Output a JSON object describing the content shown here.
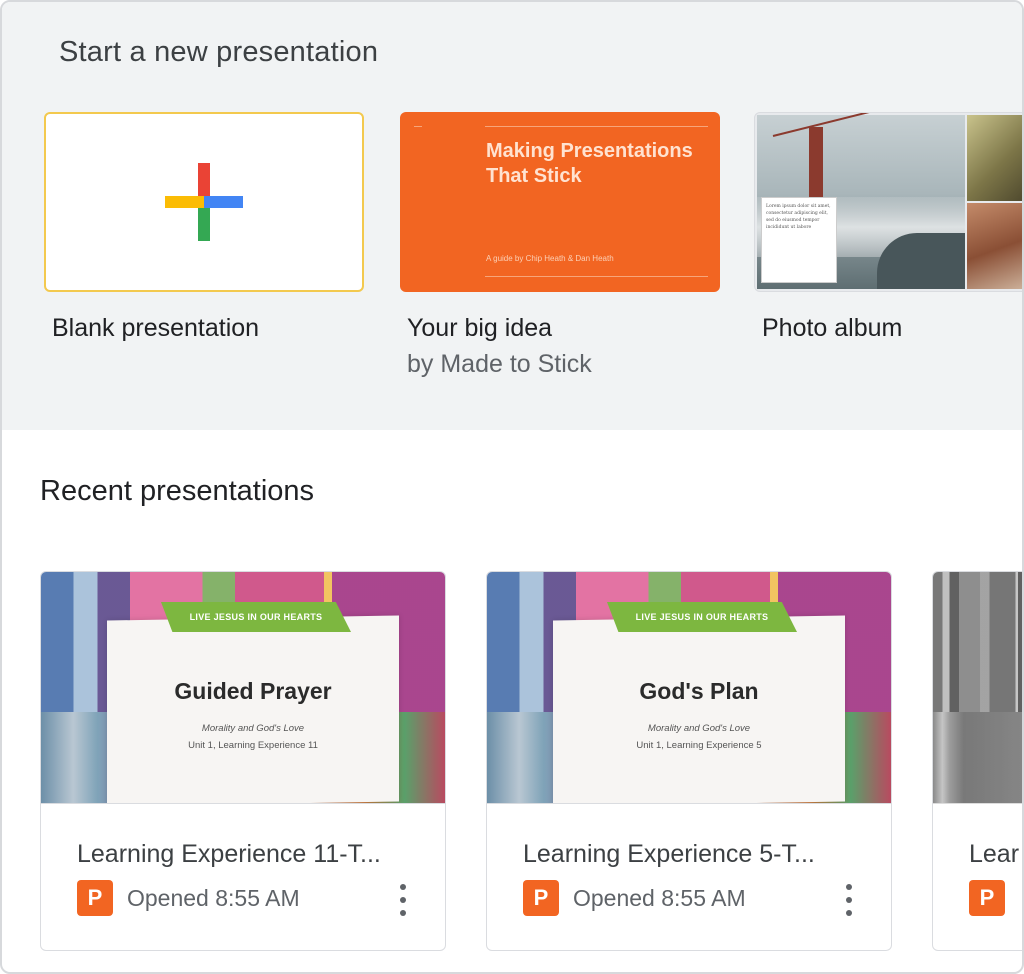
{
  "templates": {
    "heading": "Start a new presentation",
    "items": [
      {
        "label": "Blank presentation",
        "icon": "plus-icon"
      },
      {
        "label": "Your big idea",
        "byline": "by Made to Stick",
        "thumb_title": "Making Presentations That Stick",
        "thumb_sub": "A guide by Chip Heath & Dan Heath",
        "color": "#f26522"
      },
      {
        "label": "Photo album",
        "thumb_caption": "Lorem ipsum dolor sit amet, consectetur adipiscing elit, sed do eiusmod tempor incididunt ut labore"
      }
    ]
  },
  "recent": {
    "heading": "Recent presentations",
    "items": [
      {
        "name": "Learning Experience 11-T...",
        "opened": "Opened 8:55 AM",
        "ribbon": "LIVE JESUS IN OUR HEARTS",
        "slide_title": "Guided Prayer",
        "slide_line1": "Morality and God's Love",
        "slide_line2": "Unit 1, Learning Experience 11",
        "icon": "powerpoint-icon",
        "icon_letter": "P"
      },
      {
        "name": "Learning Experience 5-T...",
        "opened": "Opened 8:55 AM",
        "ribbon": "LIVE JESUS IN OUR HEARTS",
        "slide_title": "God's Plan",
        "slide_line1": "Morality and God's Love",
        "slide_line2": "Unit 1, Learning Experience 5",
        "icon": "powerpoint-icon",
        "icon_letter": "P"
      },
      {
        "name": "Lear",
        "icon": "powerpoint-icon",
        "icon_letter": "P"
      }
    ]
  },
  "colors": {
    "accent_orange": "#f26522",
    "template_bg": "#f1f3f4"
  }
}
